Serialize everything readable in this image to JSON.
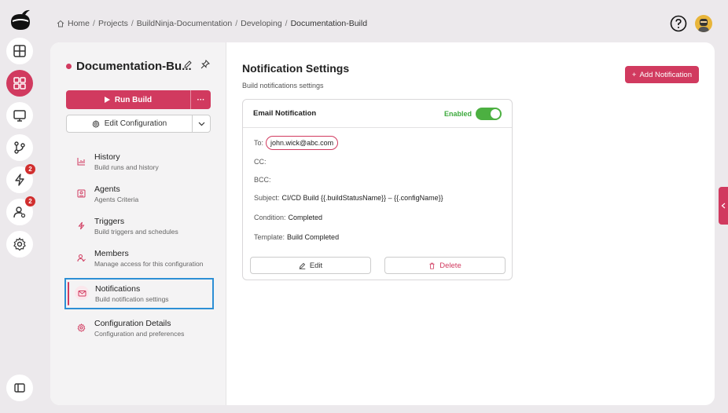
{
  "breadcrumb": {
    "home": "Home",
    "items": [
      "Projects",
      "BuildNinja-Documentation",
      "Developing"
    ],
    "current": "Documentation-Build"
  },
  "rail": {
    "badges": {
      "builds": "2",
      "users": "2"
    }
  },
  "leftpanel": {
    "title": "Documentation-Bu...",
    "run_label": "Run Build",
    "more_label": "···",
    "edit_config_label": "Edit Configuration",
    "nav": [
      {
        "title": "History",
        "subtitle": "Build runs and history",
        "icon": "chart-icon"
      },
      {
        "title": "Agents",
        "subtitle": "Agents Criteria",
        "icon": "agent-icon"
      },
      {
        "title": "Triggers",
        "subtitle": "Build triggers and schedules",
        "icon": "lightning-icon"
      },
      {
        "title": "Members",
        "subtitle": "Manage access for this configuration",
        "icon": "members-icon"
      },
      {
        "title": "Notifications",
        "subtitle": "Build notification settings",
        "icon": "mail-icon"
      },
      {
        "title": "Configuration Details",
        "subtitle": "Configuration and preferences",
        "icon": "gear-icon"
      }
    ]
  },
  "content": {
    "title": "Notification Settings",
    "subtitle": "Build notifications settings",
    "add_button": "Add Notification",
    "card": {
      "title": "Email Notification",
      "status": "Enabled",
      "to_label": "To:",
      "to_value": "john.wick@abc.com",
      "cc_label": "CC:",
      "bcc_label": "BCC:",
      "subject_label": "Subject:",
      "subject_value": "CI/CD Build {{.buildStatusName}} – {{.configName}}",
      "condition_label": "Condition:",
      "condition_value": "Completed",
      "template_label": "Template:",
      "template_value": "Build Completed",
      "edit_label": "Edit",
      "delete_label": "Delete"
    }
  },
  "colors": {
    "accent": "#d13a5f",
    "enabled": "#4cb041",
    "selection": "#2d8fd5"
  }
}
